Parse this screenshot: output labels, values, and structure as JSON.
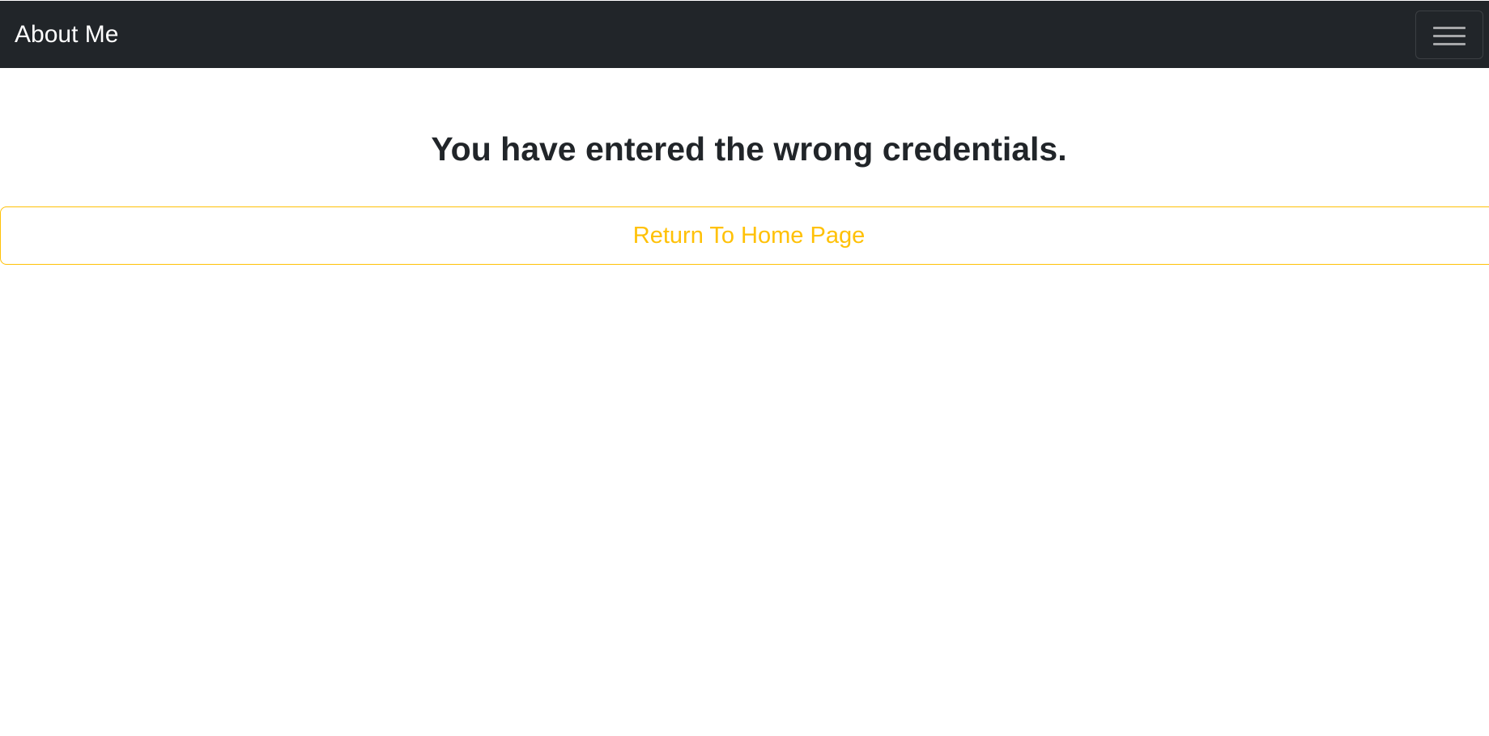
{
  "navbar": {
    "brand": "About Me",
    "toggler_icon": "hamburger-menu-icon",
    "background_color": "#212529"
  },
  "main": {
    "heading": "You have entered the wrong credentials.",
    "return_button_label": "Return To Home Page",
    "button_color": "#ffc107"
  }
}
